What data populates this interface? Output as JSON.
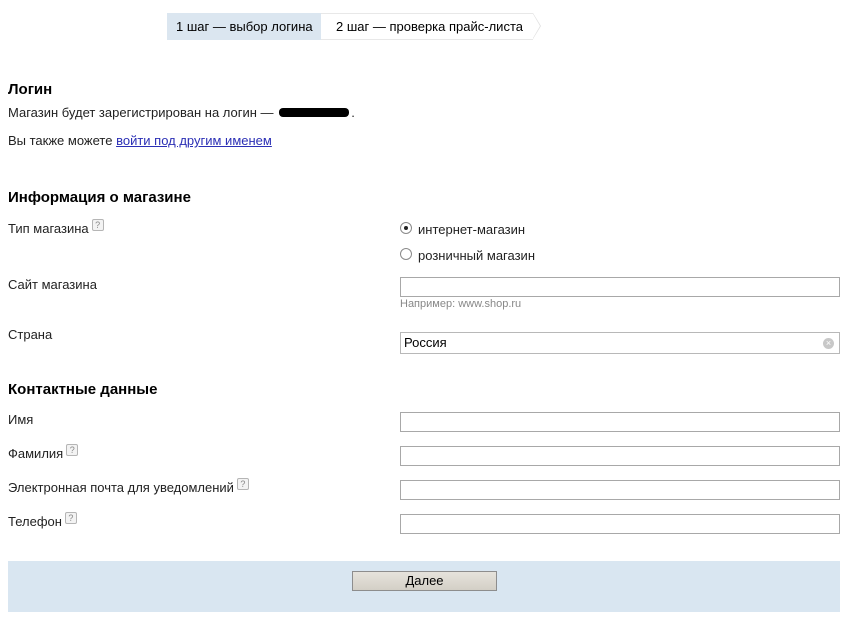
{
  "steps": [
    {
      "label": "1 шаг — выбор логина",
      "active": true
    },
    {
      "label": "2 шаг — проверка прайс-листа",
      "active": false
    }
  ],
  "login": {
    "title": "Логин",
    "registered_prefix": "Магазин будет зарегистрирован на логин —",
    "registered_suffix": ".",
    "also_prefix": "Вы также можете",
    "other_name_link": "войти под другим именем"
  },
  "shop_info": {
    "title": "Информация о магазине",
    "type_label": "Тип магазина",
    "type_options": [
      {
        "label": "интернет-магазин",
        "checked": true
      },
      {
        "label": "розничный магазин",
        "checked": false
      }
    ],
    "site_label": "Сайт магазина",
    "site_value": "",
    "site_hint": "Например: www.shop.ru",
    "country_label": "Страна",
    "country_value": "Россия"
  },
  "contacts": {
    "title": "Контактные данные",
    "first_name_label": "Имя",
    "last_name_label": "Фамилия",
    "email_label": "Электронная почта для уведомлений",
    "phone_label": "Телефон"
  },
  "help_glyph": "?",
  "clear_glyph": "×",
  "actions": {
    "next_label": "Далее"
  },
  "colors": {
    "step_active_bg": "#dbe6f0",
    "footer_bg": "#d9e6f1",
    "link": "#2b2fb5"
  }
}
